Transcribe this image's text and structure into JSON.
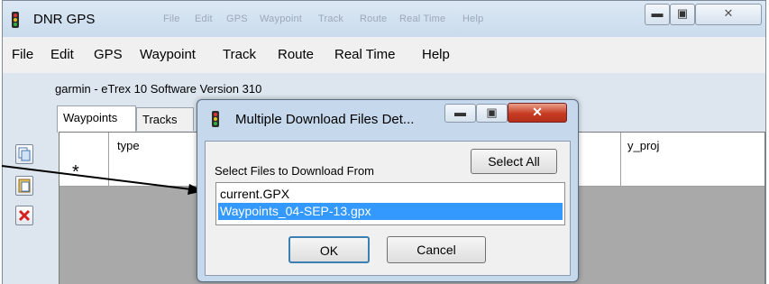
{
  "window": {
    "title": "DNR GPS",
    "ghost_menu": [
      "File",
      "Edit",
      "GPS",
      "Waypoint",
      "Track",
      "Route",
      "Real Time",
      "Help"
    ]
  },
  "menu": [
    "File",
    "Edit",
    "GPS",
    "Waypoint",
    "Track",
    "Route",
    "Real Time",
    "Help"
  ],
  "device_info": "garmin - eTrex 10 Software Version 310",
  "tabs": [
    "Waypoints",
    "Tracks"
  ],
  "grid": {
    "columns": [
      "type",
      "y_proj"
    ],
    "new_row_marker": "*"
  },
  "dialog": {
    "title": "Multiple Download Files Det...",
    "prompt": "Select Files to Download From",
    "select_all_label": "Select All",
    "files": [
      "current.GPX",
      "Waypoints_04-SEP-13.gpx"
    ],
    "selected_index": 1,
    "ok_label": "OK",
    "cancel_label": "Cancel"
  },
  "icons": {
    "app": "traffic-light-icon",
    "side_toolbar": [
      "copy-icon",
      "paste-icon",
      "delete-icon"
    ]
  },
  "colors": {
    "selection": "#3399ff",
    "close_button": "#c73b22",
    "delete_icon": "#d42020"
  }
}
